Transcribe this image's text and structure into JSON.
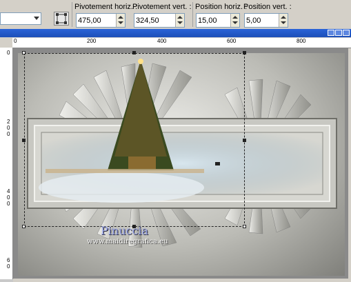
{
  "toolbar": {
    "preset": {
      "value": ""
    },
    "fields": [
      {
        "label": "Pivotement horiz. :",
        "value": "475,00"
      },
      {
        "label": "Pivotement vert. :",
        "value": "324,50"
      },
      {
        "label": "Position horiz. :",
        "value": "15,00"
      },
      {
        "label": "Position vert. :",
        "value": "5,00"
      }
    ]
  },
  "ruler_top": {
    "labels": [
      "0",
      "200",
      "400",
      "600",
      "800"
    ]
  },
  "ruler_left": {
    "labels": [
      "0",
      "2",
      "0",
      "0",
      "4",
      "0",
      "0",
      "6",
      "0"
    ]
  },
  "watermark": {
    "name": "Pinuccia",
    "url": "www.maidiregrafica.eu"
  },
  "colors": {
    "toolbar_bg": "#d4d0c8",
    "title_bar": "#2a63d8",
    "canvas_frame": "#8a8a8a"
  }
}
